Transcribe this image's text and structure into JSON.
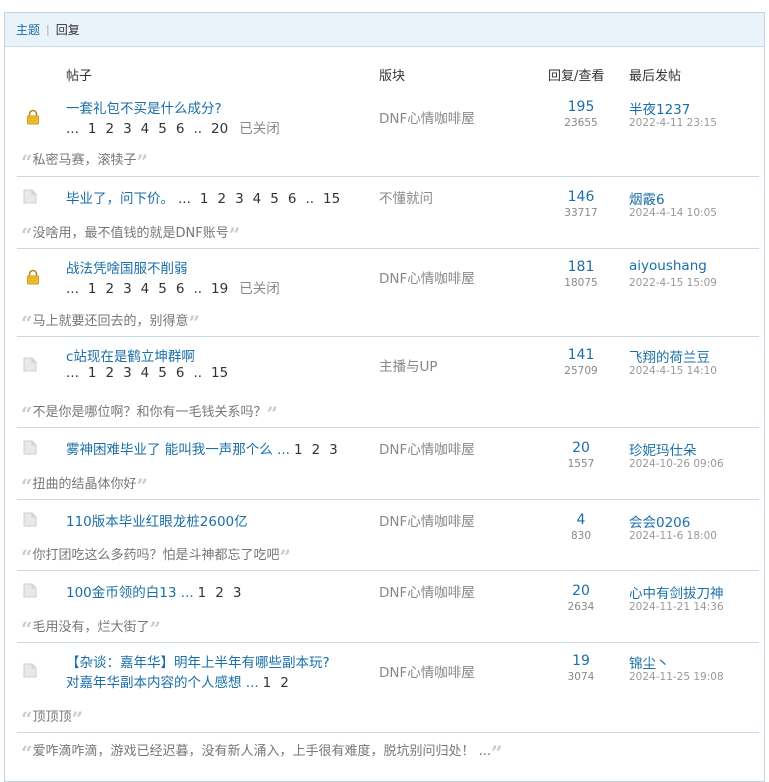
{
  "tabs": {
    "topic": "主题",
    "reply": "回复"
  },
  "columns": {
    "post": "帖子",
    "board": "版块",
    "stats": "回复/查看",
    "last": "最后发帖"
  },
  "threads": [
    {
      "title": "一套礼包不买是什么成分?",
      "pages": [
        "...",
        "1",
        "2",
        "3",
        "4",
        "5",
        "6",
        "..",
        "20"
      ],
      "closed": "已关闭",
      "board": "DNF心情咖啡屋",
      "replies": "195",
      "views": "23655",
      "last_user": "半夜1237",
      "last_date": "2022-4-11 23:15",
      "quote": "私密马赛，滚犊子",
      "locked": true
    },
    {
      "title": "毕业了，问下价。",
      "inline_pages": [
        "...",
        "1",
        "2",
        "3",
        "4",
        "5",
        "6",
        "..",
        "15"
      ],
      "board": "不懂就问",
      "replies": "146",
      "views": "33717",
      "last_user": "烟霰6",
      "last_date": "2024-4-14 10:05",
      "quote": "没啥用，最不值钱的就是DNF账号",
      "locked": false
    },
    {
      "title": "战法凭啥国服不削弱",
      "pages": [
        "...",
        "1",
        "2",
        "3",
        "4",
        "5",
        "6",
        "..",
        "19"
      ],
      "closed": "已关闭",
      "board": "DNF心情咖啡屋",
      "replies": "181",
      "views": "18075",
      "last_user": "aiyoushang",
      "last_date": "2022-4-15 15:09",
      "quote": "马上就要还回去的，别得意",
      "locked": true
    },
    {
      "title": "c站现在是鹤立坤群啊",
      "pages": [
        "...",
        "1",
        "2",
        "3",
        "4",
        "5",
        "6",
        "..",
        "15"
      ],
      "board": "主播与UP",
      "replies": "141",
      "views": "25709",
      "last_user": "飞翔的荷兰豆",
      "last_date": "2024-4-15 14:10",
      "quote": "不是你是哪位啊？和你有一毛钱关系吗？",
      "locked": false
    },
    {
      "title": "雾神困难毕业了 能叫我一声那个么 ...",
      "inline_pages": [
        "1",
        "2",
        "3"
      ],
      "board": "DNF心情咖啡屋",
      "replies": "20",
      "views": "1557",
      "last_user": "珍妮玛仕朵",
      "last_date": "2024-10-26 09:06",
      "quote": "扭曲的结晶体你好",
      "locked": false
    },
    {
      "title": "110版本毕业红眼龙桩2600亿",
      "board": "DNF心情咖啡屋",
      "replies": "4",
      "views": "830",
      "last_user": "会会0206",
      "last_date": "2024-11-6 18:00",
      "quote": "你打团吃这么多药吗？怕是斗神都忘了吃吧",
      "locked": false
    },
    {
      "title": "100金币领的白13 ...",
      "inline_pages": [
        "1",
        "2",
        "3"
      ],
      "board": "DNF心情咖啡屋",
      "replies": "20",
      "views": "2634",
      "last_user": "心中有剑拔刀神",
      "last_date": "2024-11-21 14:36",
      "quote": "毛用没有，烂大街了",
      "locked": false
    },
    {
      "title": "【杂谈：嘉年华】明年上半年有哪些副本玩?",
      "title2": "对嘉年华副本内容的个人感想 ...",
      "inline_pages2": [
        "1",
        "2"
      ],
      "board": "DNF心情咖啡屋",
      "replies": "19",
      "views": "3074",
      "last_user": "锦尘丶",
      "last_date": "2024-11-25 19:08",
      "quote": "顶顶顶",
      "locked": false
    }
  ],
  "extra_quote": "爱咋滴咋滴，游戏已经迟暮，没有新人涌入，上手很有难度，脱坑别问归处！ ...",
  "colors": {
    "link": "#1a6fa8",
    "muted": "#888888",
    "header_bg": "#eaf2fa",
    "border": "#c6d3e2"
  }
}
